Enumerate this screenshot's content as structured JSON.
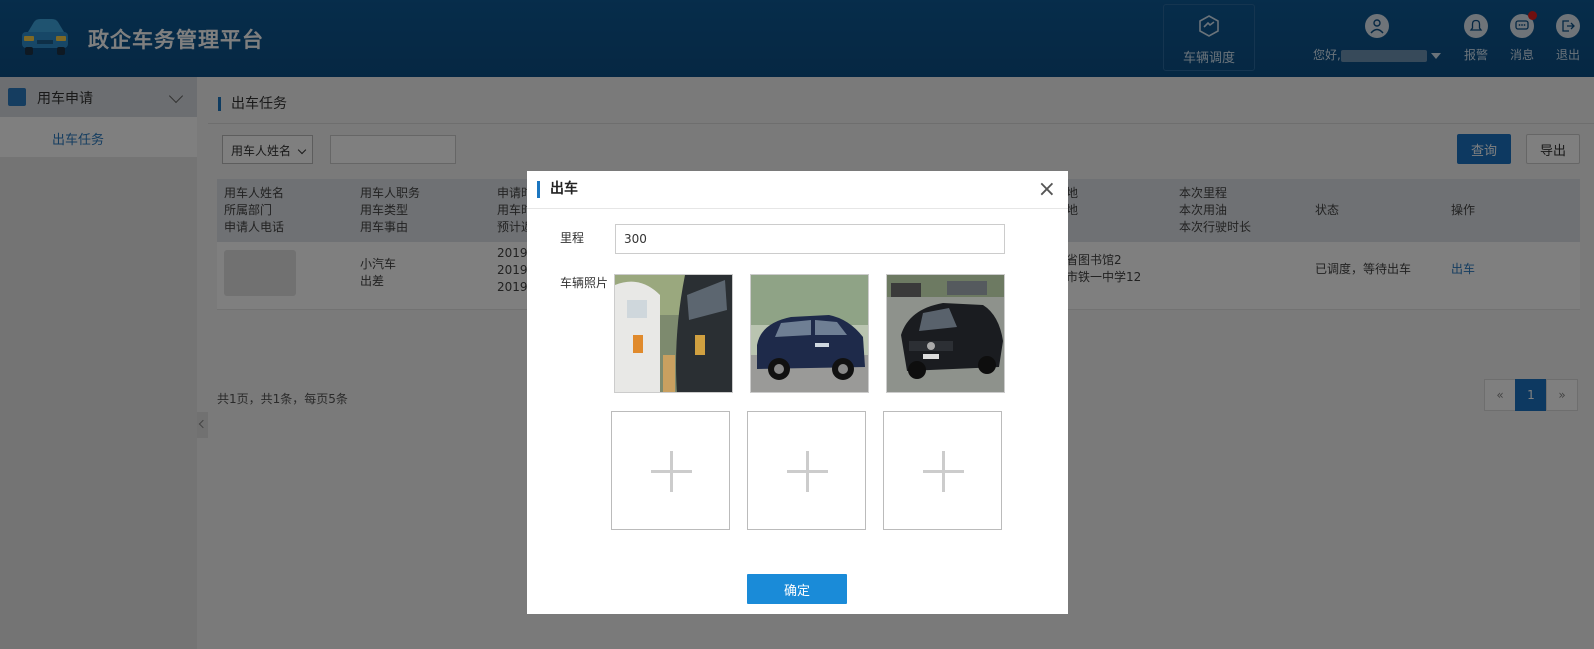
{
  "header": {
    "title": "政企车务管理平台",
    "dispatch_label": "车辆调度",
    "greeting": "您好,",
    "report_label": "报警",
    "message_label": "消息",
    "logout_label": "退出"
  },
  "sidebar": {
    "group_label": "用车申请",
    "items": [
      {
        "label": "出车任务"
      }
    ]
  },
  "main": {
    "breadcrumb": "出车任务",
    "filter": {
      "select_value": "用车人姓名",
      "input_value": ""
    },
    "query_label": "查询",
    "export_label": "导出",
    "table": {
      "headers": [
        [
          "用车人姓名",
          "所属部门",
          "申请人电话"
        ],
        [
          "用车人职务",
          "用车类型",
          "用车事由"
        ],
        [
          "申请时",
          "用车时",
          "预计返"
        ],
        [
          "地",
          "地"
        ],
        [
          "本次里程",
          "本次用油",
          "本次行驶时长"
        ],
        [
          "状态"
        ],
        [
          "操作"
        ]
      ],
      "rows": [
        {
          "position_type_reason": [
            "小汽车",
            "出差"
          ],
          "times": [
            "2019-",
            "2019-",
            "2019-"
          ],
          "places": [
            "省图书馆2",
            "市铁一中学12"
          ],
          "status": "已调度，等待出车",
          "action": "出车"
        }
      ]
    },
    "page_info": "共1页，共1条，每页5条",
    "pager": {
      "prev": "«",
      "current": "1",
      "next": "»"
    }
  },
  "modal": {
    "title": "出车",
    "close": "×",
    "mileage_label": "里程",
    "mileage_value": "300",
    "photo_label": "车辆照片",
    "confirm_label": "确定"
  },
  "colors": {
    "header_bg": "#0b4f86",
    "accent": "#1a73c3",
    "link": "#2a7ac0"
  }
}
